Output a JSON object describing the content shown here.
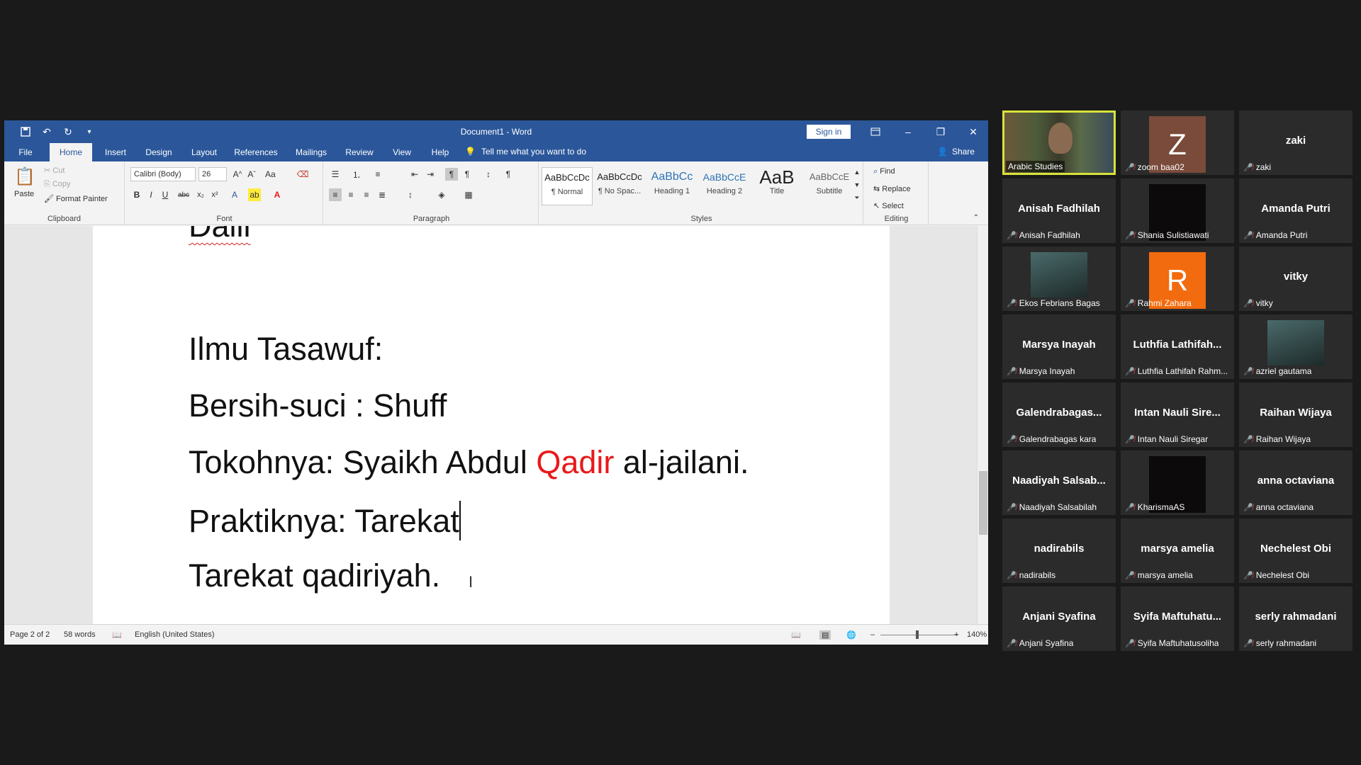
{
  "word": {
    "title": "Document1  -  Word",
    "signin": "Sign in",
    "tabs": [
      "File",
      "Home",
      "Insert",
      "Design",
      "Layout",
      "References",
      "Mailings",
      "Review",
      "View",
      "Help"
    ],
    "tellme": "Tell me what you want to do",
    "share": "Share",
    "clipboard": {
      "paste": "Paste",
      "cut": "Cut",
      "copy": "Copy",
      "format_painter": "Format Painter",
      "label": "Clipboard"
    },
    "font": {
      "name": "Calibri (Body)",
      "size": "26",
      "case": "Aa",
      "label": "Font"
    },
    "paragraph": {
      "label": "Paragraph"
    },
    "styles": {
      "label": "Styles",
      "items": [
        {
          "sample": "AaBbCcDc",
          "name": "¶ Normal"
        },
        {
          "sample": "AaBbCcDc",
          "name": "¶ No Spac..."
        },
        {
          "sample": "AaBbCc",
          "name": "Heading 1"
        },
        {
          "sample": "AaBbCcE",
          "name": "Heading 2"
        },
        {
          "sample": "AaB",
          "name": "Title"
        },
        {
          "sample": "AaBbCcE",
          "name": "Subtitle"
        }
      ]
    },
    "editing": {
      "find": "Find",
      "replace": "Replace",
      "select": "Select",
      "label": "Editing"
    },
    "document": {
      "line1": "Dalil",
      "line2": "Ilmu Tasawuf:",
      "line3": "Bersih-suci : Shuff",
      "line4_a": "Tokohnya: Syaikh Abdul ",
      "line4_red": "Qadir",
      "line4_b": " al-jailani.",
      "line5": "Praktiknya: Tarekat",
      "line6": "Tarekat qadiriyah."
    },
    "status": {
      "page": "Page 2 of 2",
      "words": "58 words",
      "language": "English (United States)",
      "zoom": "140%"
    }
  },
  "participants": [
    {
      "name": "Arabic Studies",
      "display": "",
      "type": "video"
    },
    {
      "name": "zoom baa02",
      "display": "Z",
      "type": "letter",
      "color": "#7a4a3a"
    },
    {
      "name": "zaki",
      "display": "zaki",
      "type": "name"
    },
    {
      "name": "Anisah Fadhilah",
      "display": "Anisah Fadhilah",
      "type": "name"
    },
    {
      "name": "Shania Sulistiawati",
      "display": "",
      "type": "dark"
    },
    {
      "name": "Amanda Putri",
      "display": "Amanda Putri",
      "type": "name"
    },
    {
      "name": "Ekos Febrians Bagas",
      "display": "",
      "type": "photo"
    },
    {
      "name": "Rahmi Zahara",
      "display": "R",
      "type": "letter",
      "color": "#f26b0f"
    },
    {
      "name": "vitky",
      "display": "vitky",
      "type": "name"
    },
    {
      "name": "Marsya Inayah",
      "display": "Marsya Inayah",
      "type": "name"
    },
    {
      "name": "Luthfia Lathifah Rahm...",
      "display": "Luthfia  Lathifah...",
      "type": "name"
    },
    {
      "name": "azriel gautama",
      "display": "",
      "type": "photo"
    },
    {
      "name": "Galendrabagas kara",
      "display": "Galendrabagas...",
      "type": "name"
    },
    {
      "name": "Intan Nauli Siregar",
      "display": "Intan  Nauli  Sire...",
      "type": "name"
    },
    {
      "name": "Raihan Wijaya",
      "display": "Raihan Wijaya",
      "type": "name"
    },
    {
      "name": "Naadiyah Salsabilah",
      "display": "Naadiyah  Salsab...",
      "type": "name"
    },
    {
      "name": "KharismaAS",
      "display": "",
      "type": "dark"
    },
    {
      "name": "anna octaviana",
      "display": "anna octaviana",
      "type": "name"
    },
    {
      "name": "nadirabils",
      "display": "nadirabils",
      "type": "name"
    },
    {
      "name": "marsya amelia",
      "display": "marsya amelia",
      "type": "name"
    },
    {
      "name": "Nechelest Obi",
      "display": "Nechelest Obi",
      "type": "name"
    },
    {
      "name": "Anjani Syafina",
      "display": "Anjani Syafina",
      "type": "name"
    },
    {
      "name": "Syifa Maftuhatusoliha",
      "display": "Syifa  Maftuhatu...",
      "type": "name"
    },
    {
      "name": "serly rahmadani",
      "display": "serly rahmadani",
      "type": "name"
    }
  ]
}
